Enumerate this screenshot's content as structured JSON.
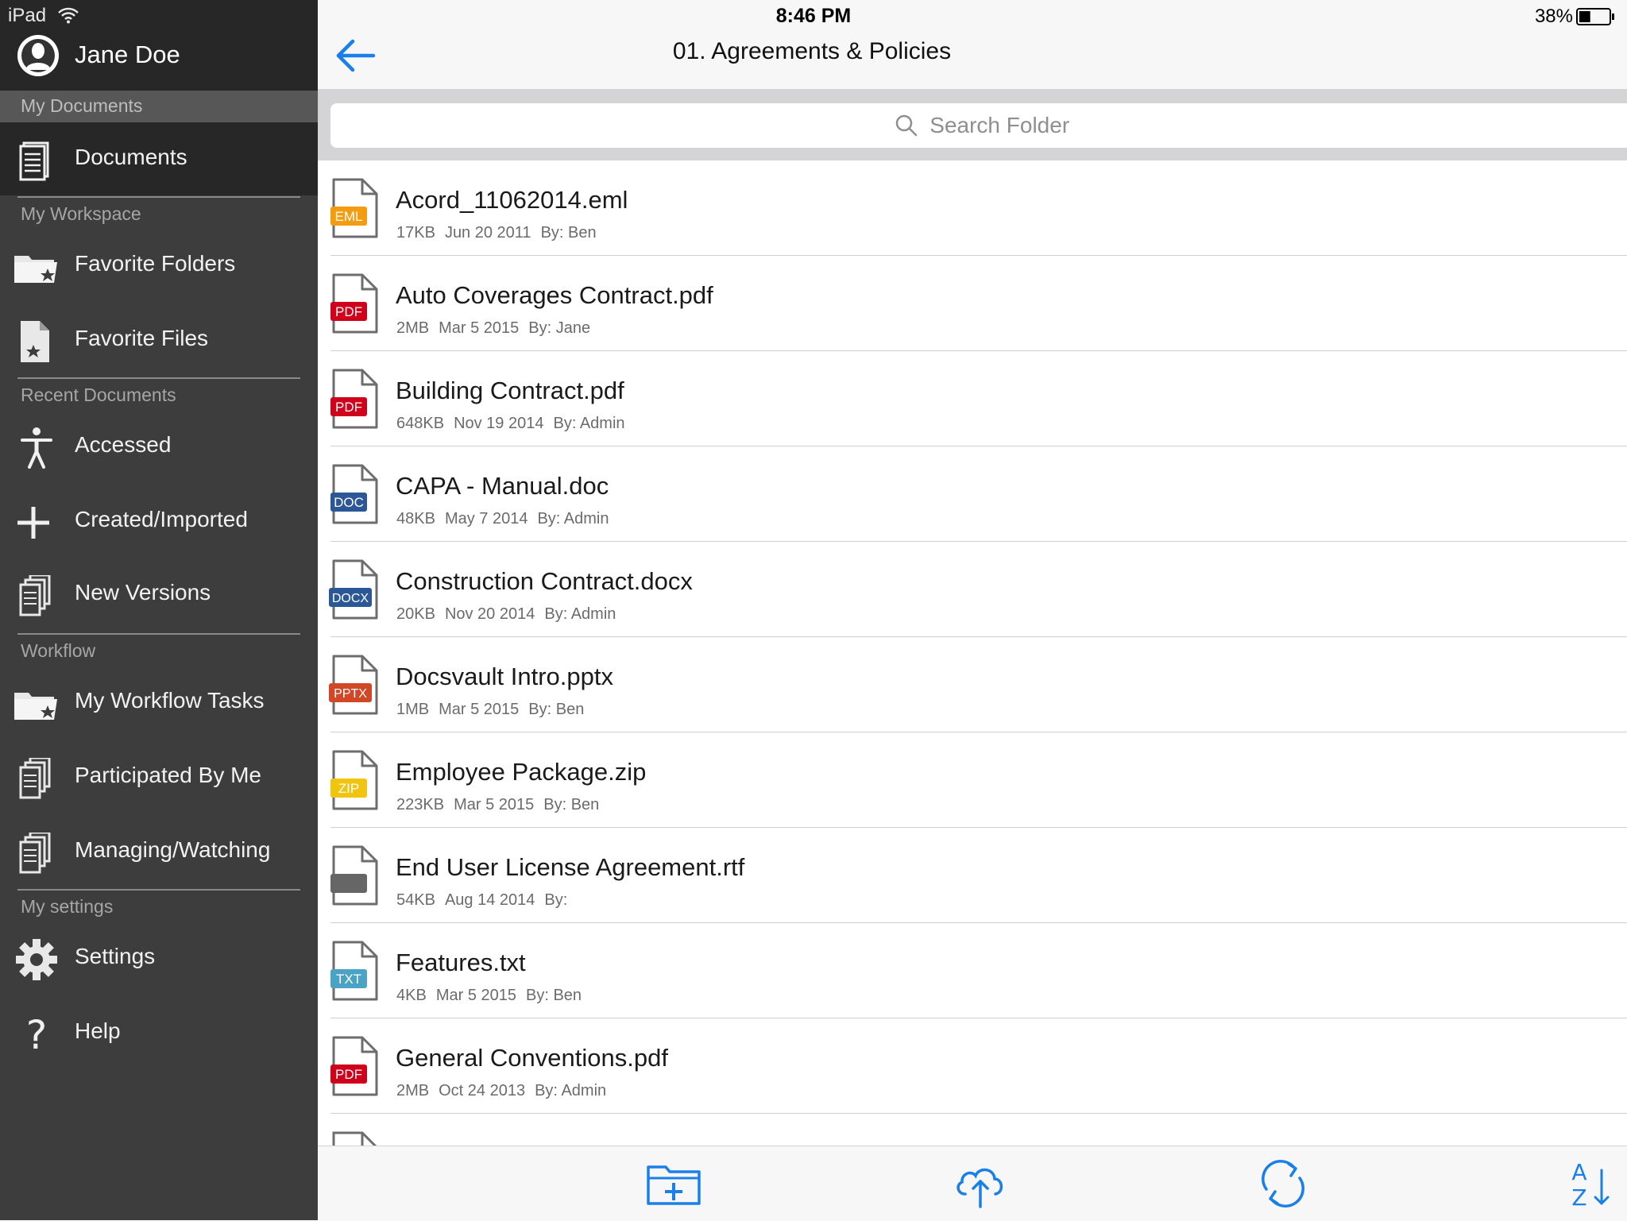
{
  "status_bar": {
    "device": "iPad",
    "time": "8:46 PM",
    "battery": "38%"
  },
  "sidebar": {
    "user_name": "Jane Doe",
    "sections": {
      "my_documents": "My Documents",
      "my_workspace": "My Workspace",
      "recent_documents": "Recent Documents",
      "workflow": "Workflow",
      "my_settings": "My settings"
    },
    "items": {
      "documents": "Documents",
      "favorite_folders": "Favorite Folders",
      "favorite_files": "Favorite Files",
      "accessed": "Accessed",
      "created_imported": "Created/Imported",
      "new_versions": "New Versions",
      "my_workflow_tasks": "My Workflow Tasks",
      "participated_by_me": "Participated By Me",
      "managing_watching": "Managing/Watching",
      "settings": "Settings",
      "help": "Help"
    }
  },
  "header": {
    "title": "01. Agreements & Policies"
  },
  "search": {
    "placeholder": "Search Folder"
  },
  "files": [
    {
      "name": "Acord_11062014.eml",
      "size": "17KB",
      "date": "Jun 20 2011",
      "by": "By: Ben",
      "badge": "EML",
      "badge_color": "#f39c12"
    },
    {
      "name": "Auto Coverages Contract.pdf",
      "size": "2MB",
      "date": "Mar 5 2015",
      "by": "By: Jane",
      "badge": "PDF",
      "badge_color": "#d0021b"
    },
    {
      "name": "Building Contract.pdf",
      "size": "648KB",
      "date": "Nov 19 2014",
      "by": "By: Admin",
      "badge": "PDF",
      "badge_color": "#d0021b"
    },
    {
      "name": "CAPA - Manual.doc",
      "size": "48KB",
      "date": "May 7 2014",
      "by": "By: Admin",
      "badge": "DOC",
      "badge_color": "#2b5797"
    },
    {
      "name": "Construction Contract.docx",
      "size": "20KB",
      "date": "Nov 20 2014",
      "by": "By: Admin",
      "badge": "DOCX",
      "badge_color": "#2b5797"
    },
    {
      "name": "Docsvault Intro.pptx",
      "size": "1MB",
      "date": "Mar 5 2015",
      "by": "By: Ben",
      "badge": "PPTX",
      "badge_color": "#d24726"
    },
    {
      "name": "Employee Package.zip",
      "size": "223KB",
      "date": "Mar 5 2015",
      "by": "By: Ben",
      "badge": "ZIP",
      "badge_color": "#f1c40f"
    },
    {
      "name": "End User License Agreement.rtf",
      "size": "54KB",
      "date": "Aug 14 2014",
      "by": "By:",
      "badge": "",
      "badge_color": "#666666"
    },
    {
      "name": "Features.txt",
      "size": "4KB",
      "date": "Mar 5 2015",
      "by": "By: Ben",
      "badge": "TXT",
      "badge_color": "#4aa3c4"
    },
    {
      "name": "General Conventions.pdf",
      "size": "2MB",
      "date": "Oct 24 2013",
      "by": "By: Admin",
      "badge": "PDF",
      "badge_color": "#d0021b"
    }
  ],
  "toolbar": {
    "icons": [
      "new-folder-icon",
      "upload-cloud-icon",
      "refresh-icon",
      "sort-az-icon"
    ]
  },
  "colors": {
    "accent": "#1a7fe8",
    "sidebar_bg": "#3d3d3d",
    "sidebar_dark": "#272727"
  }
}
